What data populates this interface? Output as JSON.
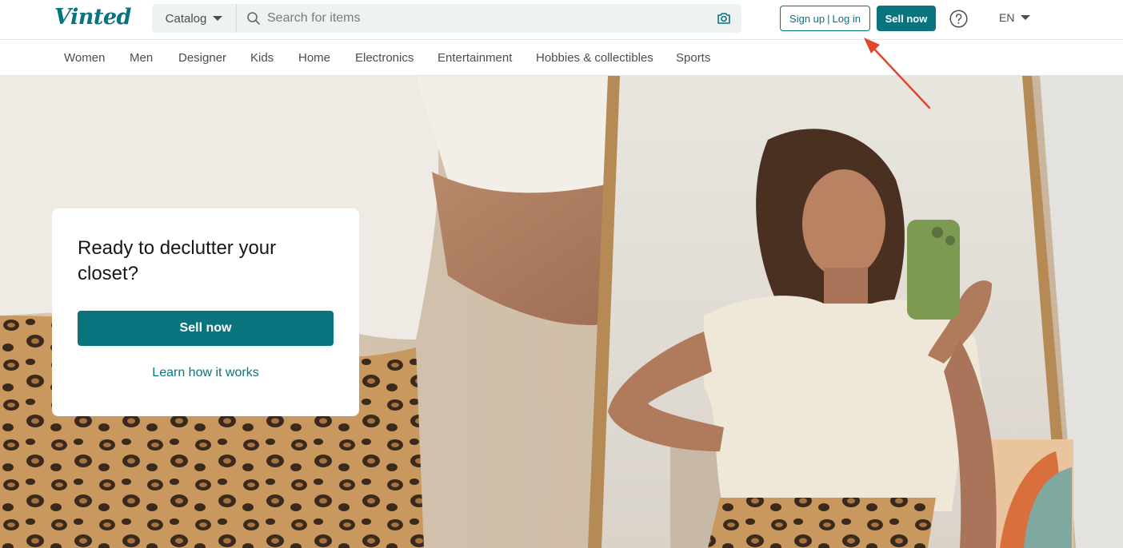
{
  "header": {
    "logo": "Vinted",
    "catalog_label": "Catalog",
    "search_placeholder": "Search for items",
    "signup_label": "Sign up",
    "separator": "|",
    "login_label": "Log in",
    "sell_label": "Sell now",
    "help_icon": "help-circle-icon",
    "language": "EN"
  },
  "nav": {
    "items": [
      "Women",
      "Men",
      "Designer",
      "Kids",
      "Home",
      "Electronics",
      "Entertainment",
      "Hobbies & collectibles",
      "Sports"
    ]
  },
  "hero": {
    "title": "Ready to declutter your closet?",
    "sell_button": "Sell now",
    "learn_link": "Learn how it works"
  },
  "colors": {
    "brand": "#09747e",
    "annotation_arrow": "#e0462b"
  }
}
